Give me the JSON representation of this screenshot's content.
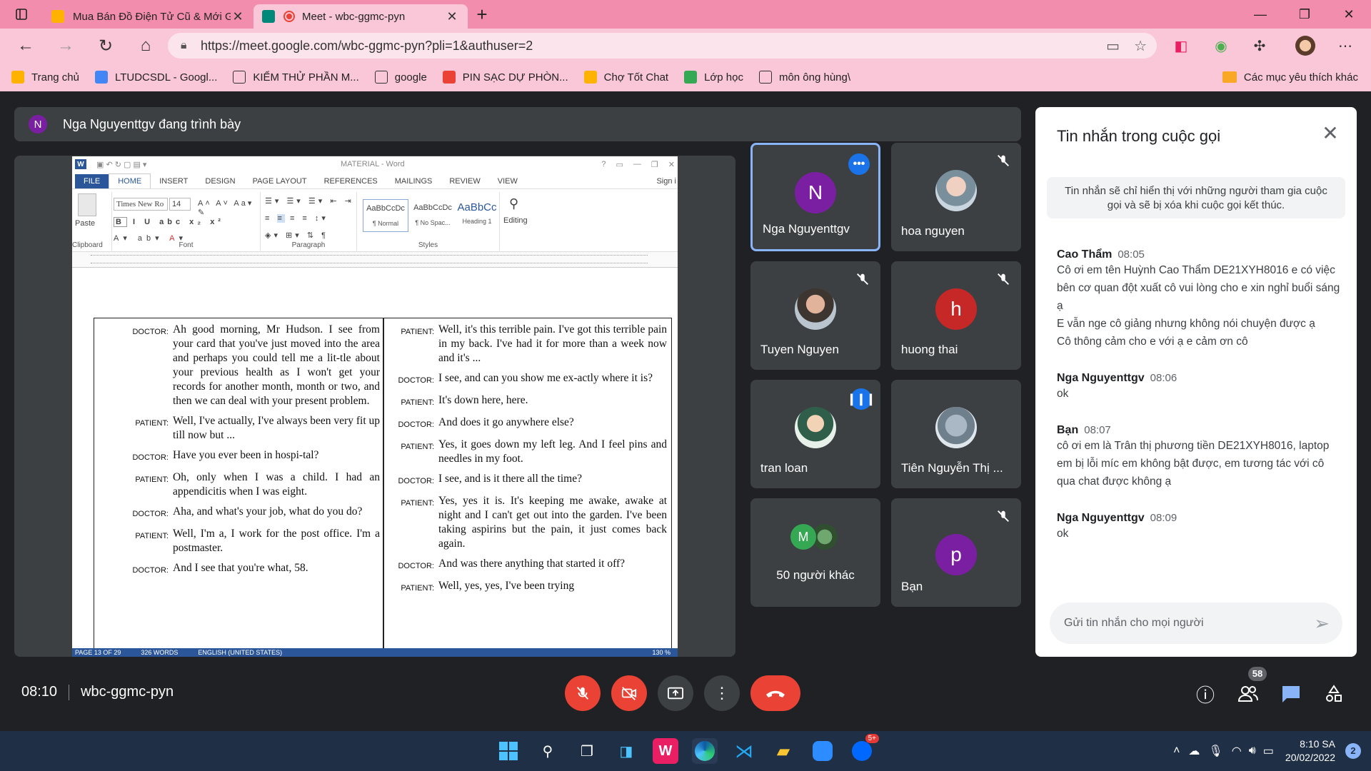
{
  "browser": {
    "tabs": [
      {
        "title": "Mua Bán Đồ Điện Tử Cũ & Mới Giá Tốt",
        "active": false,
        "favicon_color": "#ffb300"
      },
      {
        "title": "Meet - wbc-ggmc-pyn",
        "active": true,
        "favicon_color": "#ea4335"
      }
    ],
    "url": "https://meet.google.com/wbc-ggmc-pyn?pli=1&authuser=2",
    "bookmarks": [
      {
        "label": "Trang chủ",
        "color": "#ffb300"
      },
      {
        "label": "LTUDCSDL - Googl...",
        "color": "#4285f4"
      },
      {
        "label": "KIỂM THỬ PHẦN M...",
        "color": "#ffffff"
      },
      {
        "label": "google",
        "color": "#ffffff"
      },
      {
        "label": "PIN SẠC DỰ PHÒN...",
        "color": "#ea4335"
      },
      {
        "label": "Chợ Tốt Chat",
        "color": "#ffb300"
      },
      {
        "label": "Lớp học",
        "color": "#34a853"
      },
      {
        "label": "môn ông hùng\\",
        "color": "#ffffff"
      }
    ],
    "bookmarks_other": "Các mục yêu thích khác"
  },
  "meet": {
    "presenter_initial": "N",
    "presenter_text": "Nga Nguyenttgv đang trình bày",
    "meeting_time": "08:10",
    "meeting_code": "wbc-ggmc-pyn",
    "participant_count": "58",
    "tiles": [
      {
        "name": "Nga Nguyenttgv",
        "initial": "N",
        "color": "#7b1fa2",
        "speaking": true,
        "muted": false
      },
      {
        "name": "hoa nguyen",
        "initial": "",
        "color": "photo",
        "speaking": false,
        "muted": true
      },
      {
        "name": "Tuyen Nguyen",
        "initial": "",
        "color": "photo2",
        "speaking": false,
        "muted": true
      },
      {
        "name": "huong thai",
        "initial": "h",
        "color": "#c62828",
        "speaking": false,
        "muted": true
      },
      {
        "name": "tran loan",
        "initial": "",
        "color": "photo3",
        "speaking": false,
        "muted": false
      },
      {
        "name": "Tiên Nguyễn Thị ...",
        "initial": "",
        "color": "photo4",
        "speaking": false,
        "muted": false
      },
      {
        "name": "50 người khác",
        "initial": "M",
        "color": "#34a853",
        "speaking": false,
        "muted": false
      },
      {
        "name": "Bạn",
        "initial": "p",
        "color": "#7b1fa2",
        "speaking": false,
        "muted": true
      }
    ]
  },
  "word": {
    "title": "MATERIAL - Word",
    "tabs": [
      "FILE",
      "HOME",
      "INSERT",
      "DESIGN",
      "PAGE LAYOUT",
      "REFERENCES",
      "MAILINGS",
      "REVIEW",
      "VIEW"
    ],
    "signin": "Sign i",
    "font_name": "Times New Ro",
    "font_size": "14",
    "groups": [
      "Clipboard",
      "Font",
      "Paragraph",
      "Styles",
      "Editing"
    ],
    "paste_label": "Paste",
    "editing_label": "Editing",
    "styles": [
      {
        "preview": "AaBbCcDc",
        "name": "¶ Normal"
      },
      {
        "preview": "AaBbCcDc",
        "name": "¶ No Spac..."
      },
      {
        "preview": "AaBbCc",
        "name": "Heading 1"
      }
    ],
    "status": [
      "PAGE 13 OF 29",
      "326 WORDS",
      "ENGLISH (UNITED STATES)",
      "130 %"
    ],
    "left_col": [
      {
        "speaker": "DOCTOR:",
        "text": "Ah good morning, Mr Hudson. I see from your card that you've just moved into the area and perhaps you could tell me a lit-tle about your previous health as I won't get your records for another month, month or two, and then we can deal with your present problem."
      },
      {
        "speaker": "PATIENT:",
        "text": "Well, I've actually, I've always been very fit up till now but ..."
      },
      {
        "speaker": "DOCTOR:",
        "text": "Have you ever been in hospi-tal?"
      },
      {
        "speaker": "PATIENT:",
        "text": "Oh, only when I was a child. I had an appendicitis when I was eight."
      },
      {
        "speaker": "DOCTOR:",
        "text": "Aha, and what's your job, what do you do?"
      },
      {
        "speaker": "PATIENT:",
        "text": "Well, I'm a, I work for the post office. I'm a postmaster."
      },
      {
        "speaker": "DOCTOR:",
        "text": "And I see that you're what, 58."
      }
    ],
    "right_col": [
      {
        "speaker": "PATIENT:",
        "text": "Well, it's this terrible pain. I've got this terrible pain in my back. I've had it for more than a week now and it's ..."
      },
      {
        "speaker": "DOCTOR:",
        "text": "I see, and can you show me ex-actly where it is?"
      },
      {
        "speaker": "PATIENT:",
        "text": "It's down here, here."
      },
      {
        "speaker": "DOCTOR:",
        "text": "And does it go anywhere else?"
      },
      {
        "speaker": "PATIENT:",
        "text": "Yes, it goes down my left leg. And I feel pins and needles in my foot."
      },
      {
        "speaker": "DOCTOR:",
        "text": "I see, and is it there all the time?"
      },
      {
        "speaker": "PATIENT:",
        "text": "Yes, yes it is. It's keeping me awake, awake at night and I can't get out into the garden. I've been taking aspirins but the pain, it just comes back again."
      },
      {
        "speaker": "DOCTOR:",
        "text": "And was there anything that started it off?"
      },
      {
        "speaker": "PATIENT:",
        "text": "Well, yes, yes, I've been trying"
      }
    ]
  },
  "chat": {
    "title": "Tin nhắn trong cuộc gọi",
    "notice": "Tin nhắn sẽ chỉ hiển thị với những người tham gia cuộc gọi và sẽ bị xóa khi cuộc gọi kết thúc.",
    "messages": [
      {
        "sender": "Cao Thẩm",
        "time": "08:05",
        "lines": [
          "Cô ơi em tên Huỳnh Cao Thẩm DE21XYH8016 e có việc bên cơ quan đột xuất cô vui lòng cho e xin nghỉ buổi sáng ạ",
          "E vẫn nge cô giảng nhưng không nói chuyện được ạ",
          "Cô thông cảm cho e với ạ e cảm ơn cô"
        ]
      },
      {
        "sender": "Nga Nguyenttgv",
        "time": "08:06",
        "lines": [
          "ok"
        ]
      },
      {
        "sender": "Bạn",
        "time": "08:07",
        "lines": [
          "cô ơi em là Trân thị phương tiền DE21XYH8016, laptop em bị lỗi míc em không bật được, em tương tác với cô qua chat được không ạ"
        ]
      },
      {
        "sender": "Nga Nguyenttgv",
        "time": "08:09",
        "lines": [
          "ok"
        ]
      }
    ],
    "input_placeholder": "Gửi tin nhắn cho mọi người"
  },
  "taskbar": {
    "time": "8:10 SA",
    "date": "20/02/2022",
    "notif_count": "2",
    "zalo_badge": "5+"
  }
}
